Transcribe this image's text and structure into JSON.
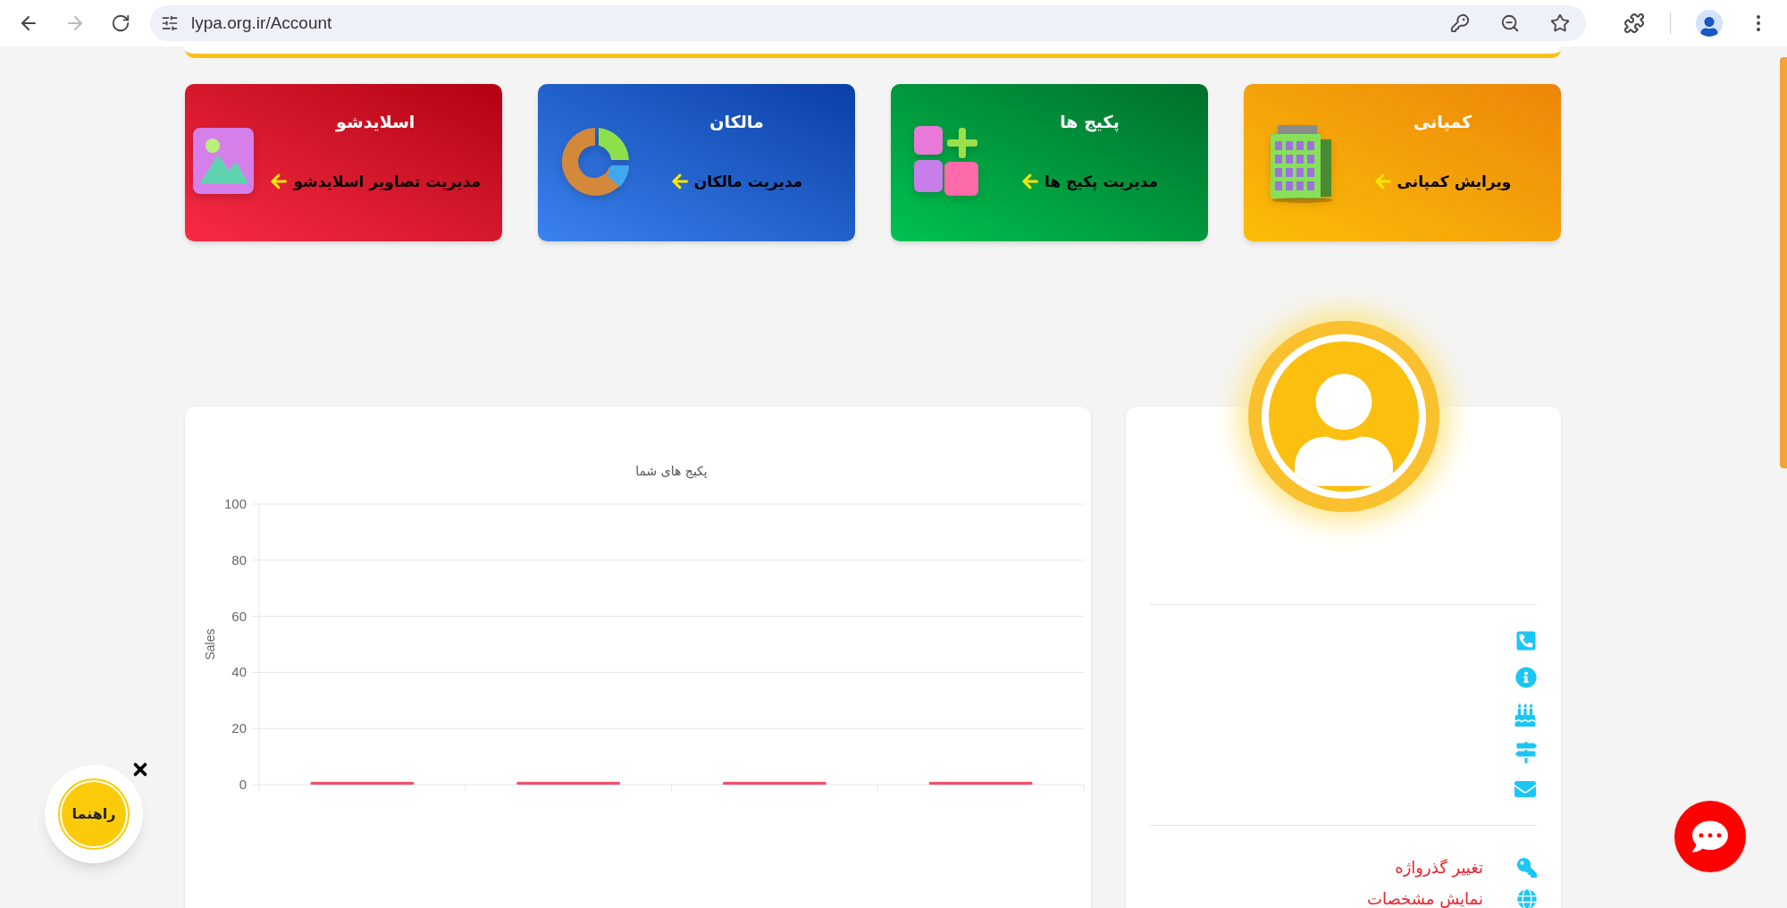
{
  "browser": {
    "url": "lypa.org.ir/Account"
  },
  "cards": [
    {
      "kind": "company",
      "title": "کمپانی",
      "link": "ویرایش کمپانی"
    },
    {
      "kind": "packages",
      "title": "پکیج ها",
      "link": "مدیریت پکیج ها"
    },
    {
      "kind": "owners",
      "title": "مالکان",
      "link": "مدیریت مالکان"
    },
    {
      "kind": "slideshow",
      "title": "اسلایدشو",
      "link": "مدیریت تصاویر اسلایدشو"
    }
  ],
  "profile": {
    "links": [
      {
        "kind": "key",
        "label": "تغییر گذرواژه"
      },
      {
        "kind": "globe",
        "label": "نمایش مشخصات"
      }
    ]
  },
  "chart": {
    "chart_data": {
      "type": "bar",
      "title": "پکیج های شما",
      "ylabel": "Sales",
      "ylim": [
        0,
        100
      ],
      "yticks": [
        0,
        20,
        40,
        60,
        80,
        100
      ],
      "grid": true,
      "values": [
        1,
        1,
        1,
        1
      ]
    }
  },
  "guide_button": {
    "label": "راهنما"
  }
}
